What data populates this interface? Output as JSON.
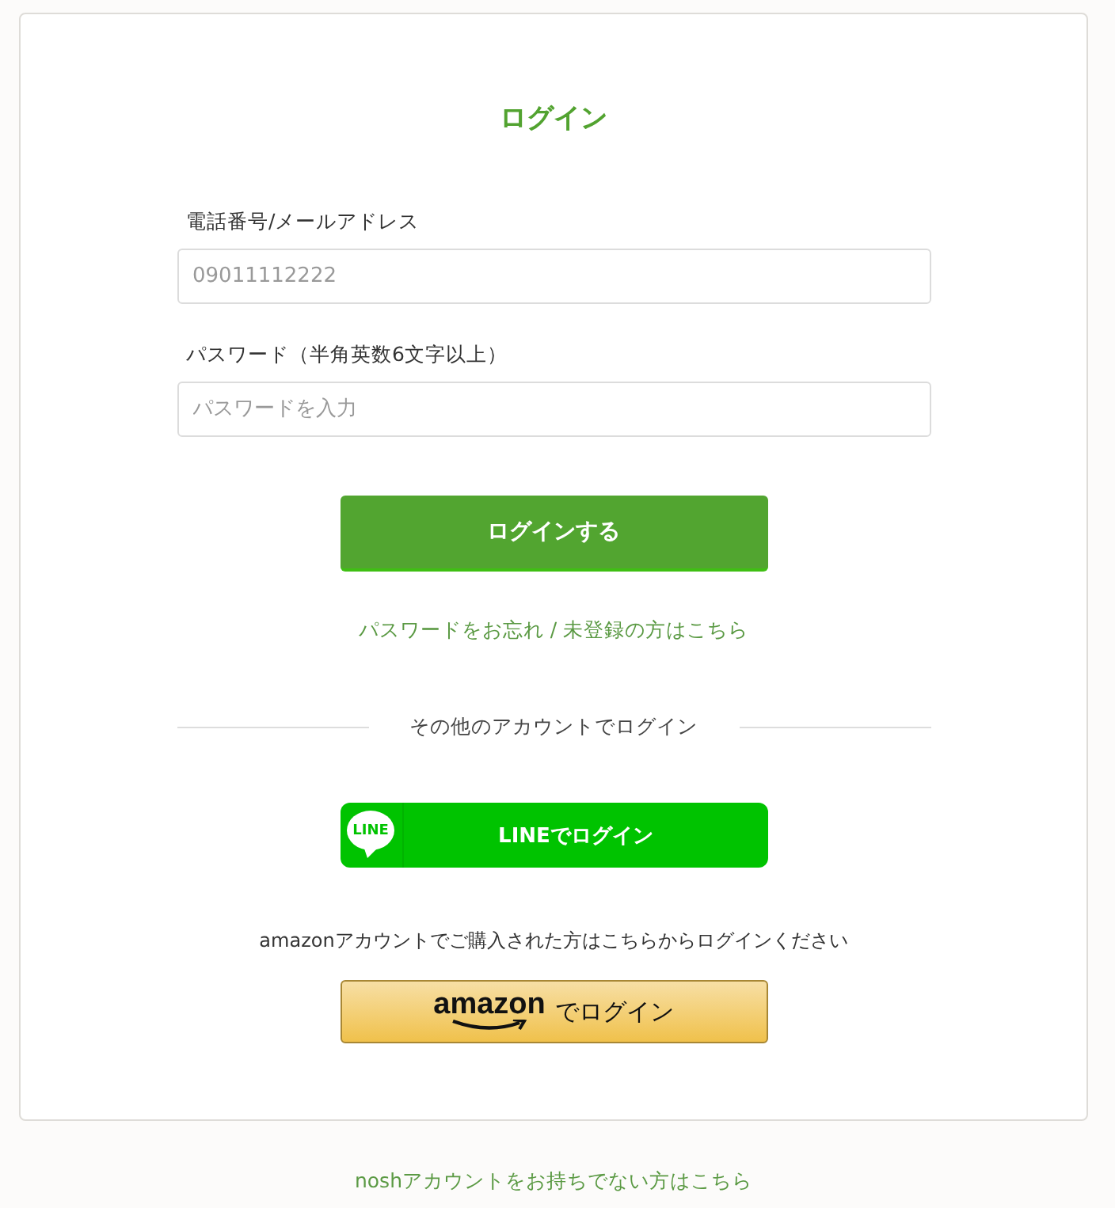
{
  "title": "ログイン",
  "fields": [
    {
      "label": "電話番号/メールアドレス",
      "placeholder": "09011112222"
    },
    {
      "label": "パスワード（半角英数6文字以上）",
      "placeholder": "パスワードを入力"
    }
  ],
  "submit": "ログインする",
  "forgot_link": "パスワードをお忘れ / 未登録の方はこちら",
  "divider": "その他のアカウントでログイン",
  "line_button": {
    "logo": "LINE",
    "label": "LINEでログイン"
  },
  "amazon_note": "amazonアカウントでご購入された方はこちらからログインください",
  "amazon_button": {
    "logo": "amazon",
    "label": "でログイン"
  },
  "footer_link": "noshアカウントをお持ちでない方はこちら"
}
